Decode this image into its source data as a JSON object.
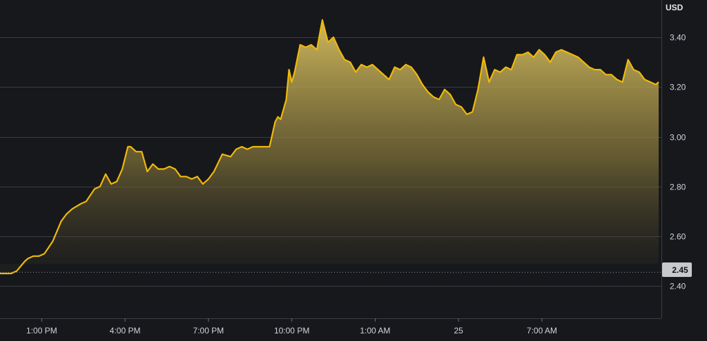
{
  "chart_data": {
    "type": "area",
    "currency": "USD",
    "y_ticks": [
      "2.40",
      "2.60",
      "2.80",
      "3.00",
      "3.20",
      "3.40"
    ],
    "ylim": [
      2.27,
      3.55
    ],
    "x_ticks": [
      {
        "label": "1:00 PM",
        "t": 1
      },
      {
        "label": "4:00 PM",
        "t": 4
      },
      {
        "label": "7:00 PM",
        "t": 7
      },
      {
        "label": "10:00 PM",
        "t": 10
      },
      {
        "label": "1:00 AM",
        "t": 13
      },
      {
        "label": "25",
        "t": 16
      },
      {
        "label": "7:00 AM",
        "t": 19
      }
    ],
    "xlim": [
      -0.5,
      23.3
    ],
    "baseline": {
      "label": "2.45",
      "value": 2.455
    },
    "line_color": "#f0b90b",
    "series": [
      {
        "x": [
          -0.5,
          -0.1,
          0.1,
          0.4,
          0.5,
          0.7,
          0.9,
          1.1,
          1.4,
          1.7,
          1.9,
          2.1,
          2.4,
          2.6,
          2.9,
          3.1,
          3.3,
          3.5,
          3.7,
          3.9,
          4.1,
          4.2,
          4.4,
          4.6,
          4.8,
          5,
          5.2,
          5.4,
          5.6,
          5.8,
          6,
          6.2,
          6.4,
          6.6,
          6.8,
          7,
          7.2,
          7.5,
          7.8,
          8,
          8.2,
          8.4,
          8.6,
          8.9,
          9.2,
          9.4,
          9.5,
          9.6,
          9.8,
          9.9,
          10,
          10.1,
          10.3,
          10.5,
          10.7,
          10.9,
          11.1,
          11.3,
          11.5,
          11.7,
          11.9,
          12.1,
          12.3,
          12.5,
          12.7,
          12.9,
          13.1,
          13.3,
          13.5,
          13.7,
          13.9,
          14.1,
          14.3,
          14.5,
          14.7,
          14.9,
          15.1,
          15.3,
          15.5,
          15.7,
          15.9,
          16.1,
          16.3,
          16.5,
          16.7,
          16.9,
          17.1,
          17.3,
          17.5,
          17.7,
          17.9,
          18.1,
          18.3,
          18.5,
          18.7,
          18.9,
          19.1,
          19.3,
          19.5,
          19.7,
          19.9,
          20.1,
          20.3,
          20.5,
          20.7,
          20.9,
          21.1,
          21.3,
          21.5,
          21.7,
          21.9,
          22.1,
          22.3,
          22.5,
          22.7,
          22.9,
          23.1,
          23.2
        ],
        "y": [
          2.45,
          2.45,
          2.46,
          2.5,
          2.51,
          2.52,
          2.52,
          2.53,
          2.58,
          2.66,
          2.69,
          2.71,
          2.73,
          2.74,
          2.79,
          2.8,
          2.85,
          2.81,
          2.82,
          2.87,
          2.96,
          2.96,
          2.94,
          2.94,
          2.86,
          2.89,
          2.87,
          2.87,
          2.88,
          2.87,
          2.84,
          2.84,
          2.83,
          2.84,
          2.81,
          2.83,
          2.86,
          2.93,
          2.92,
          2.95,
          2.96,
          2.95,
          2.96,
          2.96,
          2.96,
          3.06,
          3.08,
          3.07,
          3.15,
          3.27,
          3.22,
          3.26,
          3.37,
          3.36,
          3.37,
          3.35,
          3.47,
          3.38,
          3.4,
          3.35,
          3.31,
          3.3,
          3.26,
          3.29,
          3.28,
          3.29,
          3.27,
          3.25,
          3.23,
          3.28,
          3.27,
          3.29,
          3.28,
          3.25,
          3.21,
          3.18,
          3.16,
          3.15,
          3.19,
          3.17,
          3.13,
          3.12,
          3.09,
          3.1,
          3.19,
          3.32,
          3.22,
          3.27,
          3.26,
          3.28,
          3.27,
          3.33,
          3.33,
          3.34,
          3.32,
          3.35,
          3.33,
          3.3,
          3.34,
          3.35,
          3.34,
          3.33,
          3.32,
          3.3,
          3.28,
          3.27,
          3.27,
          3.25,
          3.25,
          3.23,
          3.22,
          3.31,
          3.27,
          3.26,
          3.23,
          3.22,
          3.21,
          3.22
        ]
      }
    ]
  }
}
